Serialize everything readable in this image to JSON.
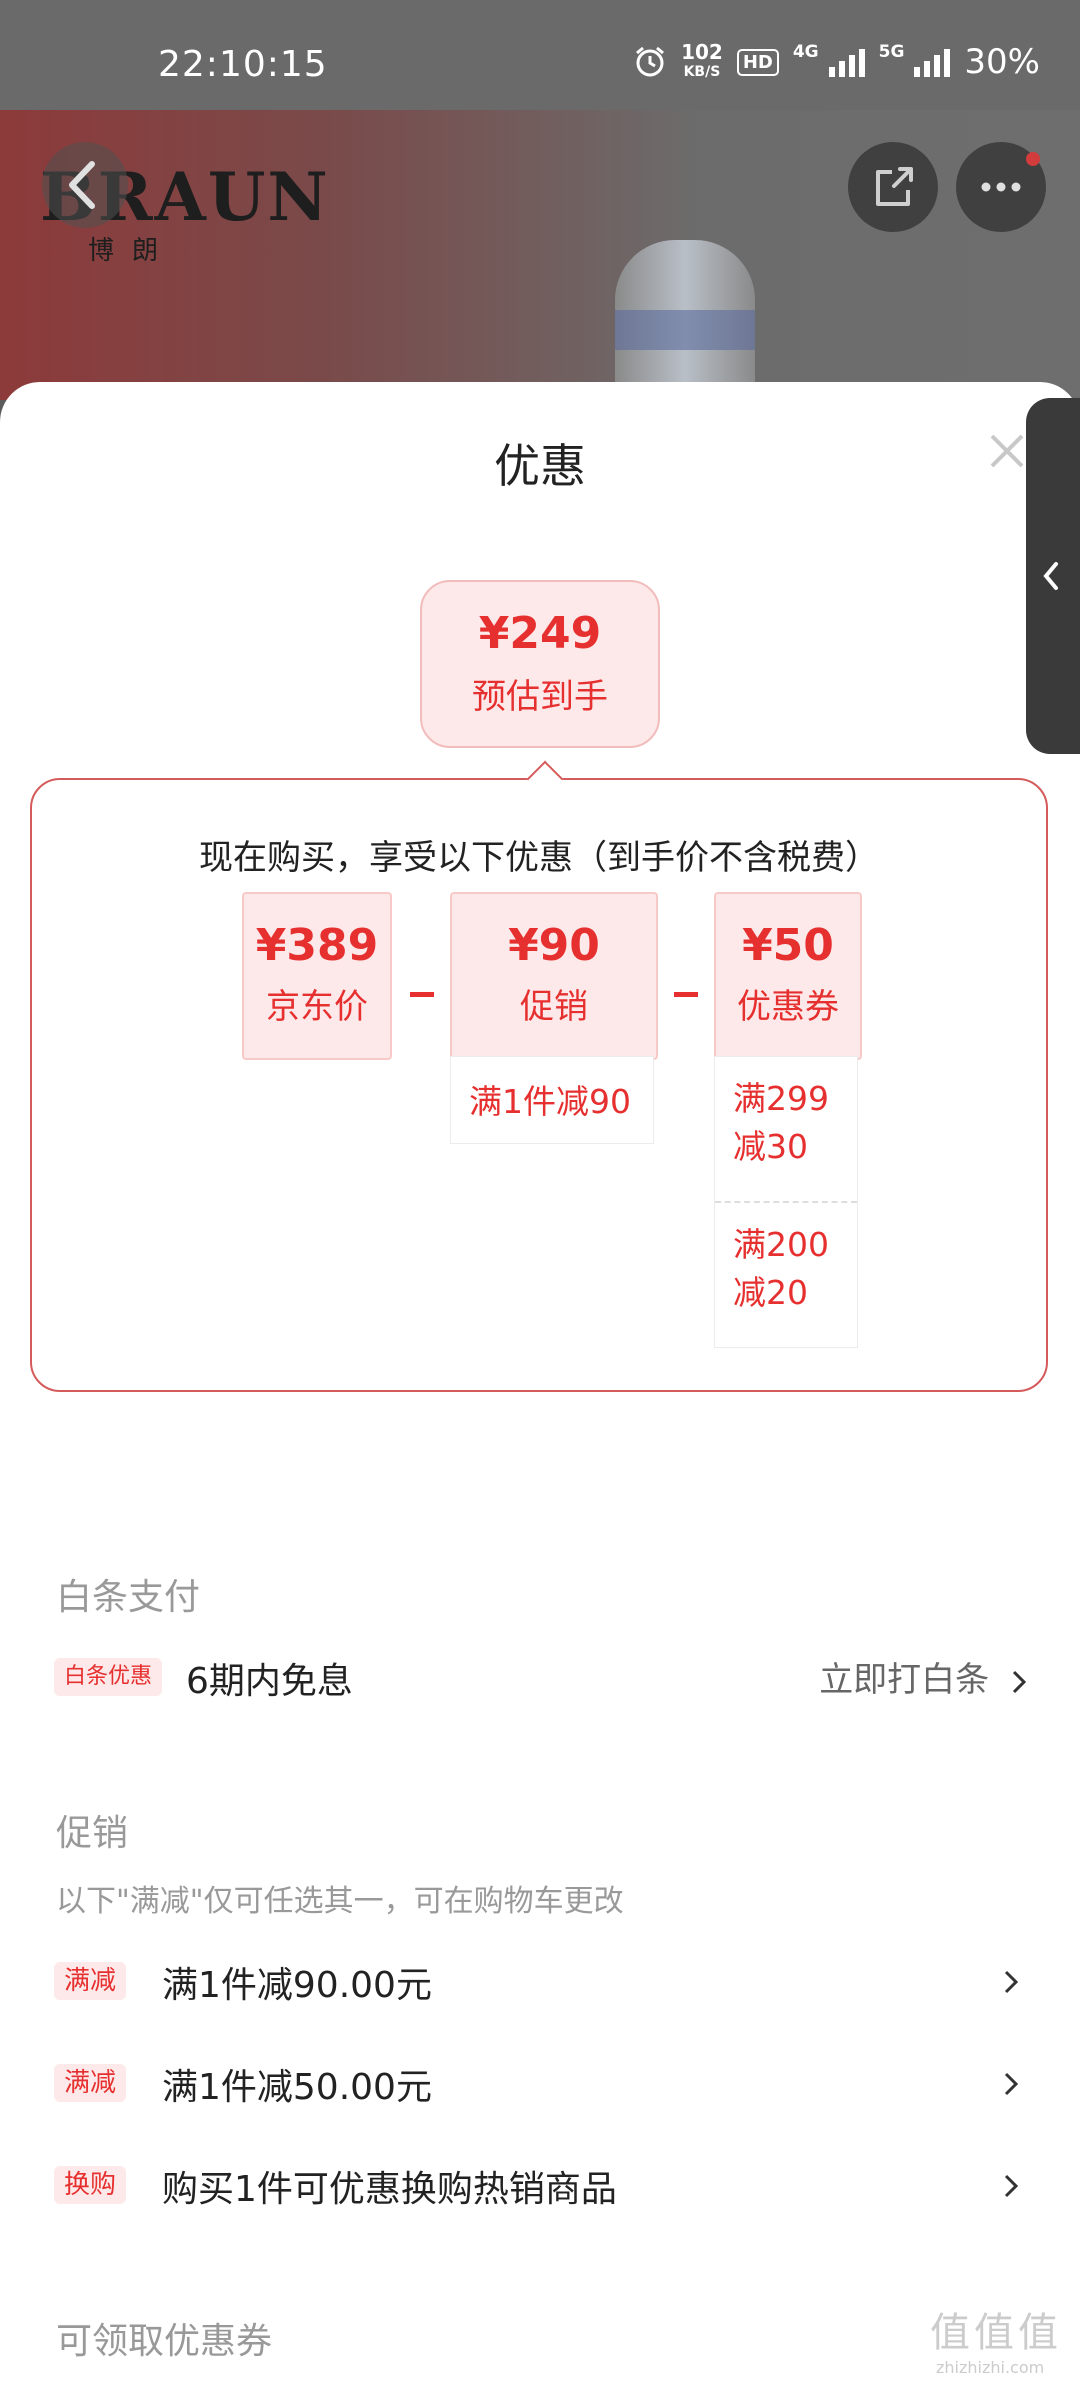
{
  "status_bar": {
    "time": "22:10:15",
    "net_speed": "102",
    "net_unit": "KB/S",
    "hd": "HD",
    "net_4g": "4G",
    "net_5g": "5G",
    "battery": "30%"
  },
  "header": {
    "brand_logo": "BRAUN",
    "brand_cn": "博朗",
    "icons": [
      "back-arrow-icon",
      "share-icon",
      "more-icon"
    ]
  },
  "sheet": {
    "title": "优惠",
    "estimate": {
      "price": "¥249",
      "label": "预估到手"
    },
    "breakdown": {
      "heading": "现在购买，享受以下优惠（到手价不含税费）",
      "items": [
        {
          "value": "¥389",
          "label": "京东价"
        },
        {
          "value": "¥90",
          "label": "促销"
        },
        {
          "value": "¥50",
          "label": "优惠券"
        }
      ],
      "promo_details": [
        "满1件减90"
      ],
      "coupon_details": [
        {
          "line1": "满299",
          "line2": "减30"
        },
        {
          "line1": "满200",
          "line2": "减20"
        }
      ]
    }
  },
  "baitiao": {
    "title": "白条支付",
    "badge": "白条优惠",
    "text": "6期内免息",
    "action": "立即打白条"
  },
  "promotion": {
    "title": "促销",
    "note": "以下\"满减\"仅可任选其一，可在购物车更改",
    "items": [
      {
        "badge": "满减",
        "text": "满1件减90.00元"
      },
      {
        "badge": "满减",
        "text": "满1件减50.00元"
      },
      {
        "badge": "换购",
        "text": "购买1件可优惠换购热销商品"
      }
    ]
  },
  "coupons": {
    "title": "可领取优惠券"
  },
  "watermark": {
    "main": "值值值",
    "site": "zhizhizhi.com"
  },
  "colors": {
    "accent": "#e6302f",
    "accent_bg": "#fde9e9"
  }
}
